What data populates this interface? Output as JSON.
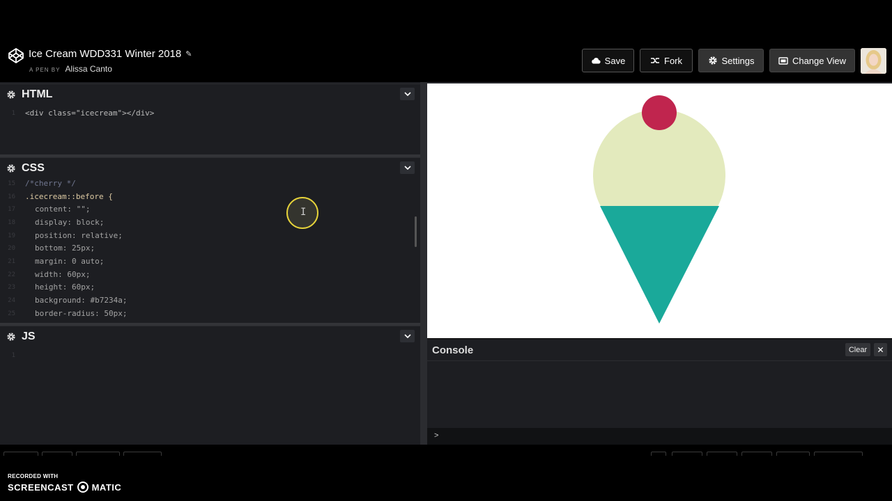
{
  "header": {
    "pen_title": "Ice Cream WDD331 Winter 2018",
    "by_label": "A PEN BY",
    "author": "Alissa Canto",
    "buttons": {
      "save": "Save",
      "fork": "Fork",
      "settings": "Settings",
      "change_view": "Change View"
    }
  },
  "editors": {
    "html": {
      "title": "HTML",
      "lines": [
        {
          "num": "1",
          "text": "<div class=\"icecream\"></div>"
        }
      ]
    },
    "css": {
      "title": "CSS",
      "lines": [
        {
          "num": "15",
          "text": "/*cherry */"
        },
        {
          "num": "16",
          "text": ".icecream::before {"
        },
        {
          "num": "17",
          "text": "content: \"\";"
        },
        {
          "num": "18",
          "text": "display: block;"
        },
        {
          "num": "19",
          "text": "position: relative;"
        },
        {
          "num": "20",
          "text": "bottom: 25px;"
        },
        {
          "num": "21",
          "text": "margin: 0 auto;"
        },
        {
          "num": "22",
          "text": "width: 60px;"
        },
        {
          "num": "23",
          "text": "height: 60px;"
        },
        {
          "num": "24",
          "text": "background: #b7234a;"
        },
        {
          "num": "25",
          "text": "border-radius: 50px;"
        }
      ]
    },
    "js": {
      "title": "JS",
      "lines": [
        {
          "num": "1",
          "text": ""
        }
      ]
    }
  },
  "preview": {
    "colors": {
      "cherry": "#c0254e",
      "scoop": "#e3eabd",
      "cone": "#1aa99a"
    }
  },
  "console": {
    "title": "Console",
    "clear": "Clear",
    "close_icon": "x-icon",
    "prompt": ">"
  },
  "recorder": {
    "line1": "RECORDED WITH",
    "brand_left": "SCREENCAST",
    "brand_right": "MATIC"
  },
  "colors": {
    "background": "#000000",
    "editor_bg": "#1d1e22",
    "accent_cursor": "#e5d23a"
  }
}
